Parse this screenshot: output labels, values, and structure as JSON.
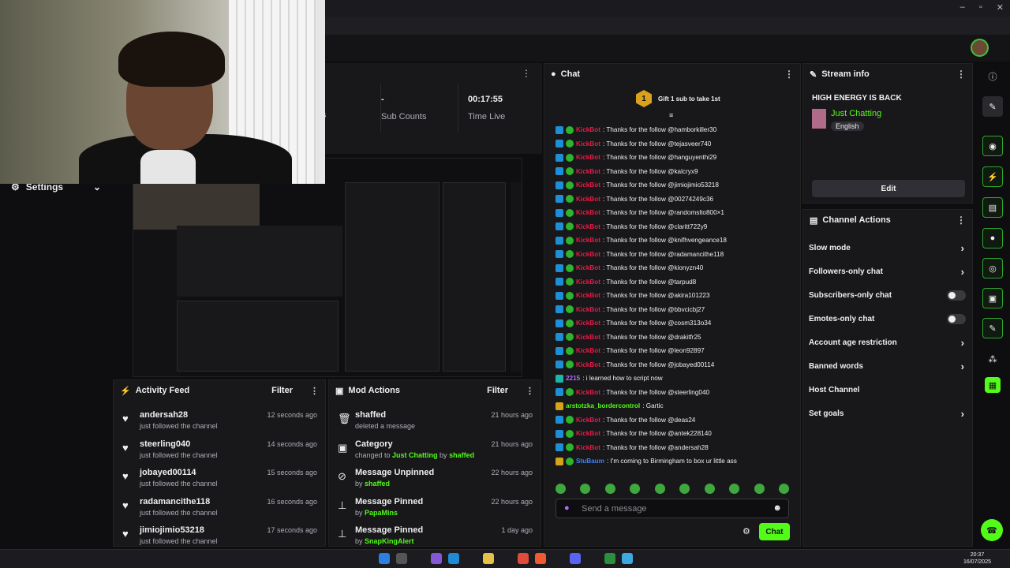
{
  "os": {
    "time": "20:37",
    "date": "16/07/2025"
  },
  "settings": {
    "label": "Settings"
  },
  "stats": {
    "sub_counts_value": "-",
    "sub_counts_label": "Sub Counts",
    "time_live_value": "00:17:55",
    "time_live_label": "Time Live",
    "partial_label": "s"
  },
  "activity_feed": {
    "title": "Activity Feed",
    "filter": "Filter",
    "items": [
      {
        "name": "andersah28",
        "action": "just followed the channel",
        "time": "12 seconds ago"
      },
      {
        "name": "steerling040",
        "action": "just followed the channel",
        "time": "14 seconds ago"
      },
      {
        "name": "jobayed00114",
        "action": "just followed the channel",
        "time": "15 seconds ago"
      },
      {
        "name": "radamancithe118",
        "action": "just followed the channel",
        "time": "16 seconds ago"
      },
      {
        "name": "jimiojimio53218",
        "action": "just followed the channel",
        "time": "17 seconds ago"
      }
    ]
  },
  "mod_actions": {
    "title": "Mod Actions",
    "filter": "Filter",
    "items": [
      {
        "title": "shaffed",
        "sub1": "deleted a message",
        "link": "",
        "sub2": "",
        "link2": "",
        "time": "21 hours ago",
        "icon": "trash-icon"
      },
      {
        "title": "Category",
        "sub1": "changed to ",
        "link": "Just Chatting",
        "sub2": " by ",
        "link2": "shaffed",
        "time": "21 hours ago",
        "icon": "category-icon"
      },
      {
        "title": "Message Unpinned",
        "sub1": "by ",
        "link": "shaffed",
        "sub2": "",
        "link2": "",
        "time": "22 hours ago",
        "icon": "unpin-icon"
      },
      {
        "title": "Message Pinned",
        "sub1": "by ",
        "link": "PapaMins",
        "sub2": "",
        "link2": "",
        "time": "22 hours ago",
        "icon": "pin-icon"
      },
      {
        "title": "Message Pinned",
        "sub1": "by ",
        "link": "SnapKingAlert",
        "sub2": "",
        "link2": "",
        "time": "1 day ago",
        "icon": "pin-icon"
      }
    ]
  },
  "chat": {
    "title": "Chat",
    "gift_rank": "1",
    "gift_text": "Gift 1 sub to take 1st",
    "placeholder": "Send a message",
    "send_label": "Chat",
    "messages": [
      {
        "user": "KickBot",
        "text": ": Thanks for the follow @hamborkiller30",
        "color": "#e91a48",
        "badges": [
          "b1",
          "b2"
        ]
      },
      {
        "user": "KickBot",
        "text": ": Thanks for the follow @tejasveer740",
        "color": "#e91a48",
        "badges": [
          "b1",
          "b2"
        ]
      },
      {
        "user": "KickBot",
        "text": ": Thanks for the follow @hanguyenthi29",
        "color": "#e91a48",
        "badges": [
          "b1",
          "b2"
        ]
      },
      {
        "user": "KickBot",
        "text": ": Thanks for the follow @kalcryx9",
        "color": "#e91a48",
        "badges": [
          "b1",
          "b2"
        ]
      },
      {
        "user": "KickBot",
        "text": ": Thanks for the follow @jimiojimio53218",
        "color": "#e91a48",
        "badges": [
          "b1",
          "b2"
        ]
      },
      {
        "user": "KickBot",
        "text": ": Thanks for the follow @00274249c36",
        "color": "#e91a48",
        "badges": [
          "b1",
          "b2"
        ]
      },
      {
        "user": "KickBot",
        "text": ": Thanks for the follow @randomslto800×1",
        "color": "#e91a48",
        "badges": [
          "b1",
          "b2"
        ]
      },
      {
        "user": "KickBot",
        "text": ": Thanks for the follow @claritt722y9",
        "color": "#e91a48",
        "badges": [
          "b1",
          "b2"
        ]
      },
      {
        "user": "KickBot",
        "text": ": Thanks for the follow @knifhvengeance18",
        "color": "#e91a48",
        "badges": [
          "b1",
          "b2"
        ]
      },
      {
        "user": "KickBot",
        "text": ": Thanks for the follow @radamancithe118",
        "color": "#e91a48",
        "badges": [
          "b1",
          "b2"
        ]
      },
      {
        "user": "KickBot",
        "text": ": Thanks for the follow @kionyzn40",
        "color": "#e91a48",
        "badges": [
          "b1",
          "b2"
        ]
      },
      {
        "user": "KickBot",
        "text": ": Thanks for the follow @tarpud8",
        "color": "#e91a48",
        "badges": [
          "b1",
          "b2"
        ]
      },
      {
        "user": "KickBot",
        "text": ": Thanks for the follow @akira101223",
        "color": "#e91a48",
        "badges": [
          "b1",
          "b2"
        ]
      },
      {
        "user": "KickBot",
        "text": ": Thanks for the follow @bbvcicbj27",
        "color": "#e91a48",
        "badges": [
          "b1",
          "b2"
        ]
      },
      {
        "user": "KickBot",
        "text": ": Thanks for the follow @cosm313o34",
        "color": "#e91a48",
        "badges": [
          "b1",
          "b2"
        ]
      },
      {
        "user": "KickBot",
        "text": ": Thanks for the follow @drakitfr25",
        "color": "#e91a48",
        "badges": [
          "b1",
          "b2"
        ]
      },
      {
        "user": "KickBot",
        "text": ": Thanks for the follow @leon92897",
        "color": "#e91a48",
        "badges": [
          "b1",
          "b2"
        ]
      },
      {
        "user": "KickBot",
        "text": ": Thanks for the follow @jobayed00114",
        "color": "#e91a48",
        "badges": [
          "b1",
          "b2"
        ]
      },
      {
        "user": "2215",
        "text": ": i learned how to script now",
        "color": "#b46cff",
        "badges": [
          "b4"
        ]
      },
      {
        "user": "KickBot",
        "text": ": Thanks for the follow @steerling040",
        "color": "#e91a48",
        "badges": [
          "b1",
          "b2"
        ]
      },
      {
        "user": "arstotzka_bordercontrol",
        "text": ": Gartic",
        "color": "#53fc18",
        "badges": [
          "b3"
        ]
      },
      {
        "user": "KickBot",
        "text": ": Thanks for the follow @deas24",
        "color": "#e91a48",
        "badges": [
          "b1",
          "b2"
        ]
      },
      {
        "user": "KickBot",
        "text": ": Thanks for the follow @antek228140",
        "color": "#e91a48",
        "badges": [
          "b1",
          "b2"
        ]
      },
      {
        "user": "KickBot",
        "text": ": Thanks for the follow @andersah28",
        "color": "#e91a48",
        "badges": [
          "b1",
          "b2"
        ]
      },
      {
        "user": "StuBaum",
        "text": ": I'm coming to Birmingham to box ur little ass",
        "color": "#3b82f6",
        "badges": [
          "b3",
          "b2"
        ]
      }
    ]
  },
  "stream_info": {
    "title": "Stream info",
    "stream_title": "HIGH ENERGY IS BACK",
    "category": "Just Chatting",
    "language": "English",
    "edit": "Edit"
  },
  "channel_actions": {
    "title": "Channel Actions",
    "items": [
      {
        "label": "Slow mode",
        "type": "chevron"
      },
      {
        "label": "Followers-only chat",
        "type": "chevron"
      },
      {
        "label": "Subscribers-only chat",
        "type": "toggle"
      },
      {
        "label": "Emotes-only chat",
        "type": "toggle"
      },
      {
        "label": "Account age restriction",
        "type": "chevron"
      },
      {
        "label": "Banned words",
        "type": "chevron"
      },
      {
        "label": "Host Channel",
        "type": "none"
      },
      {
        "label": "Set goals",
        "type": "chevron"
      }
    ]
  },
  "colors": {
    "accent": "#53fc18",
    "kickbot": "#e91a48"
  }
}
